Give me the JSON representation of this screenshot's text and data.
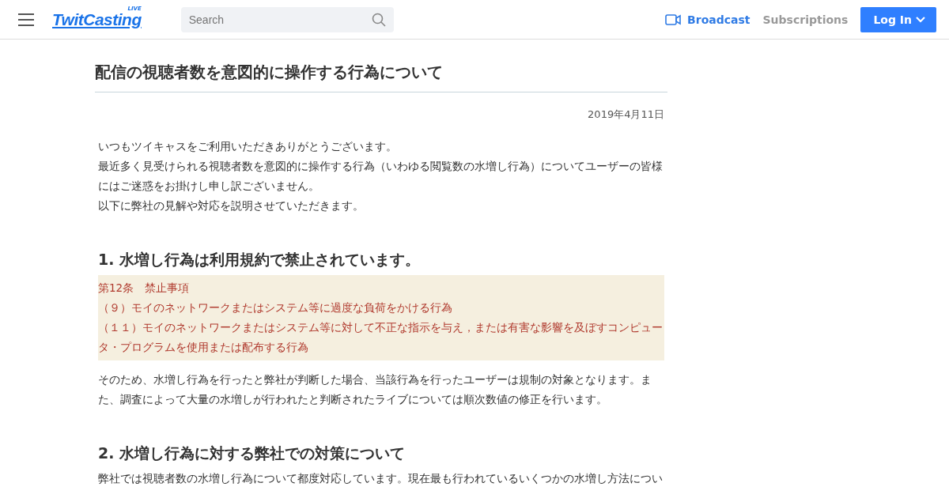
{
  "header": {
    "logo": "TwitCasting",
    "logo_badge": "LIVE",
    "search": {
      "placeholder": "Search"
    },
    "nav": [
      {
        "label": "Broadcast",
        "kind": "broadcast"
      },
      {
        "label": "Subscriptions",
        "kind": "plain"
      }
    ],
    "login": "Log In"
  },
  "article": {
    "title": "配信の視聴者数を意図的に操作する行為について",
    "date": "2019年4月11日",
    "intro": [
      "いつもツイキャスをご利用いただきありがとうございます。",
      "最近多く見受けられる視聴者数を意図的に操作する行為（いわゆる閲覧数の水増し行為）についてユーザーの皆様にはご迷惑をお掛けし申し訳ございません。",
      "以下に弊社の見解や対応を説明させていただきます。"
    ],
    "sections": [
      {
        "heading": "1. 水増し行為は利用規約で禁止されています。",
        "quote": [
          "第12条　禁止事項",
          "（９）モイのネットワークまたはシステム等に過度な負荷をかける行為",
          "（１１）モイのネットワークまたはシステム等に対して不正な指示を与え，または有害な影響を及ぼすコンピュータ・プログラムを使用または配布する行為"
        ],
        "body": "そのため、水増し行為を行ったと弊社が判断した場合、当該行為を行ったユーザーは規制の対象となります。また、調査によって大量の水増しが行われたと判断されたライブについては順次数値の修正を行います。"
      },
      {
        "heading": "2. 水増し行為に対する弊社での対策について",
        "body": "弊社では視聴者数の水増し行為について都度対応しています。現在最も行われているいくつかの水増し方法につい"
      }
    ]
  }
}
